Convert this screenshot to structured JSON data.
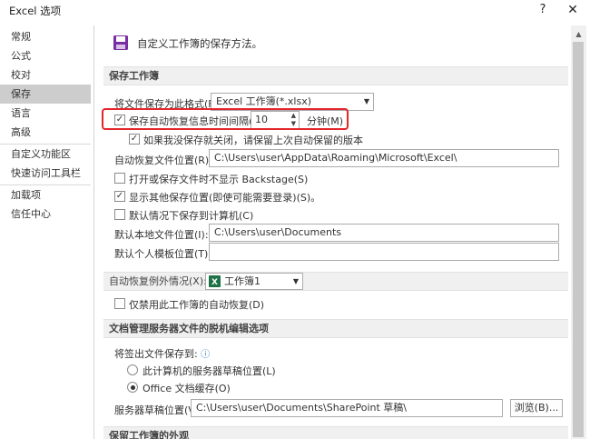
{
  "window": {
    "title": "Excel 选项",
    "help_label": "?",
    "close_label": "✕"
  },
  "nav": {
    "items": [
      "常规",
      "公式",
      "校对",
      "保存",
      "语言",
      "高级",
      "自定义功能区",
      "快速访问工具栏",
      "加载项",
      "信任中心"
    ],
    "active": "保存"
  },
  "header": {
    "title": "自定义工作簿的保存方法。",
    "icon": "floppy-disk-icon",
    "icon_color": "#7a2ea3"
  },
  "save_section": {
    "heading": "保存工作簿",
    "format_label": "将文件保存为此格式(F):",
    "format_value": "Excel 工作簿(*.xlsx)",
    "autorecover_label": "保存自动恢复信息时间间隔(A)",
    "autorecover_checked": true,
    "autorecover_minutes": "10",
    "minutes_label": "分钟(M)",
    "keep_last_label": "如果我没保存就关闭，请保留上次自动保留的版本",
    "keep_last_checked": true,
    "autorecover_location_label": "自动恢复文件位置(R):",
    "autorecover_location_value": "C:\\Users\\user\\AppData\\Roaming\\Microsoft\\Excel\\",
    "no_backstage_label": "打开或保存文件时不显示 Backstage(S)",
    "no_backstage_checked": false,
    "show_other_locations_label": "显示其他保存位置(即使可能需要登录)(S)。",
    "show_other_locations_checked": true,
    "default_to_computer_label": "默认情况下保存到计算机(C)",
    "default_to_computer_checked": false,
    "default_local_label": "默认本地文件位置(I):",
    "default_local_value": "C:\\Users\\user\\Documents",
    "personal_templates_label": "默认个人模板位置(T):",
    "personal_templates_value": ""
  },
  "autorecover_exceptions": {
    "label": "自动恢复例外情况(X):",
    "workbook_value": "工作簿1",
    "disable_label": "仅禁用此工作簿的自动恢复(D)",
    "disable_checked": false
  },
  "offline_section": {
    "heading": "文档管理服务器文件的脱机编辑选项",
    "save_checked_out_label": "将签出文件保存到:",
    "option_server_label": "此计算机的服务器草稿位置(L)",
    "option_office_label": "Office 文档缓存(O)",
    "selected": "Office 文档缓存(O)",
    "drafts_label": "服务器草稿位置(V):",
    "drafts_value": "C:\\Users\\user\\Documents\\SharePoint 草稿\\",
    "browse_label": "浏览(B)..."
  },
  "preserve_section": {
    "heading": "保留工作簿的外观"
  },
  "colors": {
    "highlight": "#e3262a",
    "active_nav": "#cdcdcd",
    "excel_green": "#1e7145"
  }
}
